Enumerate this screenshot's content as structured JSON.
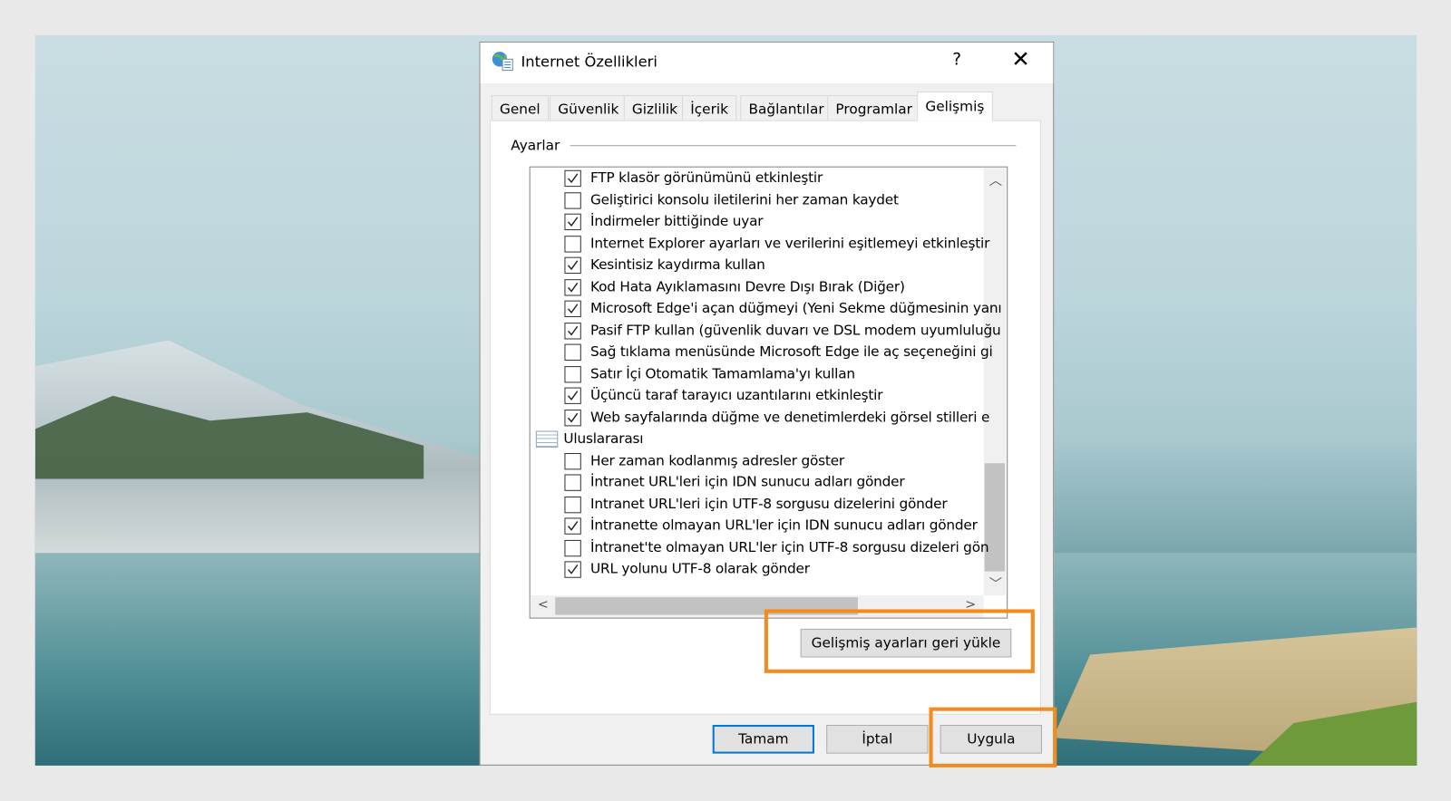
{
  "dialog": {
    "title": "Internet Özellikleri",
    "help_label": "?",
    "close_label": "✕"
  },
  "tabs": [
    {
      "label": "Genel"
    },
    {
      "label": "Güvenlik"
    },
    {
      "label": "Gizlilik"
    },
    {
      "label": "İçerik"
    },
    {
      "label": "Bağlantılar"
    },
    {
      "label": "Programlar"
    },
    {
      "label": "Gelişmiş",
      "active": true
    }
  ],
  "settings": {
    "group_label": "Ayarlar",
    "items": [
      {
        "label": "FTP klasör görünümünü etkinleştir",
        "checked": true
      },
      {
        "label": "Geliştirici konsolu iletilerini her zaman kaydet",
        "checked": false
      },
      {
        "label": "İndirmeler bittiğinde uyar",
        "checked": true
      },
      {
        "label": "Internet Explorer ayarları ve verilerini eşitlemeyi etkinleştir",
        "checked": false
      },
      {
        "label": "Kesintisiz kaydırma kullan",
        "checked": true
      },
      {
        "label": "Kod Hata Ayıklamasını Devre Dışı Bırak (Diğer)",
        "checked": true
      },
      {
        "label": "Microsoft Edge'i açan düğmeyi (Yeni Sekme düğmesinin yanı",
        "checked": true
      },
      {
        "label": "Pasif FTP kullan (güvenlik duvarı ve DSL modem uyumluluğu",
        "checked": true
      },
      {
        "label": "Sağ tıklama menüsünde Microsoft Edge ile aç seçeneğini gi",
        "checked": false
      },
      {
        "label": "Satır İçi Otomatik Tamamlama'yı kullan",
        "checked": false
      },
      {
        "label": "Üçüncü taraf tarayıcı uzantılarını etkinleştir",
        "checked": true
      },
      {
        "label": "Web sayfalarında düğme ve denetimlerdeki görsel stilleri e",
        "checked": true
      },
      {
        "label": "Uluslararası",
        "category": true
      },
      {
        "label": "Her zaman kodlanmış adresler göster",
        "checked": false
      },
      {
        "label": "İntranet URL'leri için IDN sunucu adları gönder",
        "checked": false
      },
      {
        "label": "Intranet URL'leri için UTF-8 sorgusu dizelerini gönder",
        "checked": false
      },
      {
        "label": "İntranette olmayan URL'ler için IDN sunucu adları gönder",
        "checked": true
      },
      {
        "label": "İntranet'te olmayan URL'ler için UTF-8 sorgusu dizeleri gön",
        "checked": false
      },
      {
        "label": "URL yolunu UTF-8 olarak gönder",
        "checked": true
      }
    ]
  },
  "restore_button": "Gelişmiş ayarları geri yükle",
  "footer": {
    "ok": "Tamam",
    "cancel": "İptal",
    "apply": "Uygula"
  },
  "colors": {
    "highlight": "#f28c1f",
    "default_button_border": "#0078d7"
  }
}
